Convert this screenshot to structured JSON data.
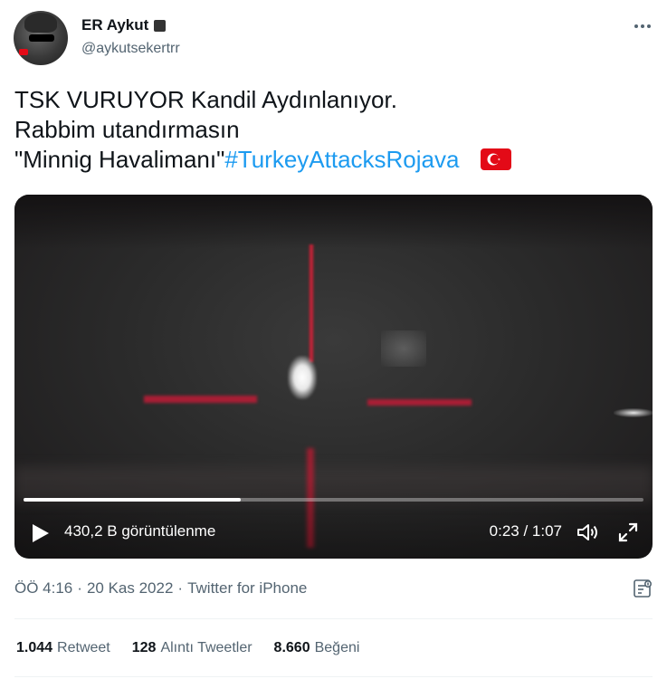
{
  "author": {
    "display_name": "ER Aykut",
    "handle": "@aykutsekertrr"
  },
  "tweet": {
    "line1": "TSK VURUYOR Kandil Aydınlanıyor.",
    "line2": "Rabbim utandırmasın",
    "line3_text": "\"Minnig Havalimanı\"",
    "hashtag": "#TurkeyAttacksRojava",
    "flag_icon": "turkey-flag-emoji"
  },
  "video": {
    "views": "430,2 B görüntülenme",
    "time": "0:23 / 1:07",
    "progress": 0.35
  },
  "meta": {
    "time": "ÖÖ 4:16",
    "sep1": "·",
    "date": "20 Kas 2022",
    "sep2": "·",
    "source": "Twitter for iPhone"
  },
  "stats": {
    "retweets_num": "1.044",
    "retweets_label": "Retweet",
    "quotes_num": "128",
    "quotes_label": "Alıntı Tweetler",
    "likes_num": "8.660",
    "likes_label": "Beğeni"
  },
  "colors": {
    "accent": "#1d9bf0",
    "text_secondary": "#536471"
  }
}
